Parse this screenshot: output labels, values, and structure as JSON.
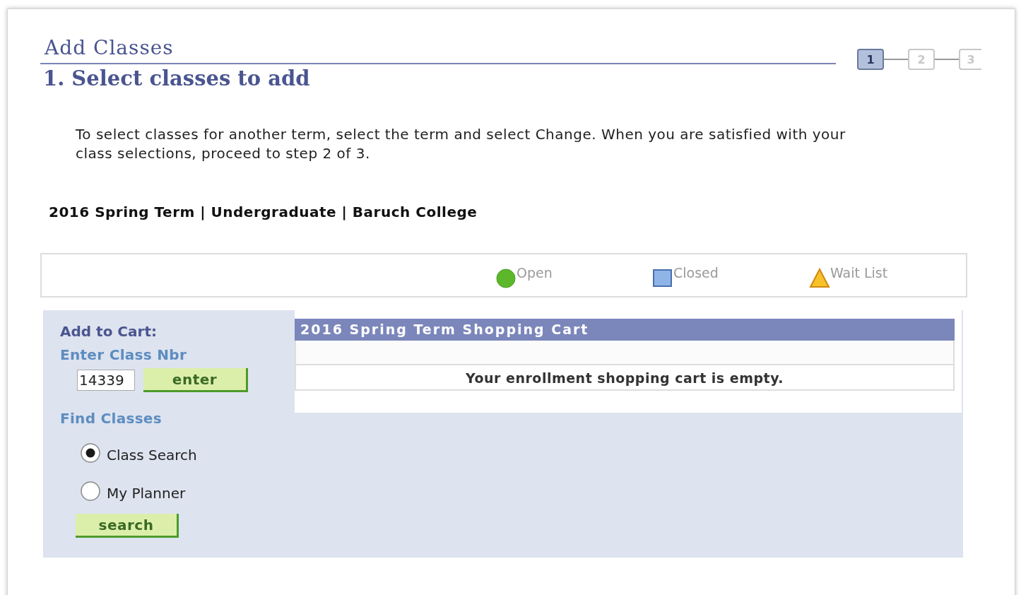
{
  "header": {
    "title": "Add Classes",
    "subtitle": "1.  Select classes to add"
  },
  "steps": [
    {
      "label": "1",
      "selected": true
    },
    {
      "label": "2",
      "selected": false
    },
    {
      "label": "3",
      "selected": false
    }
  ],
  "instructions": "To select classes for another term, select the term and select Change.  When you are satisfied with your class selections, proceed to step 2 of 3.",
  "term": "2016 Spring Term | Undergraduate | Baruch College",
  "legend": [
    {
      "kind": "circle",
      "label": "Open",
      "color": "#5cb82a"
    },
    {
      "kind": "square",
      "label": "Closed",
      "color": "#8fb4e8"
    },
    {
      "kind": "triangle",
      "label": "Wait List",
      "color": "#f7c12a"
    }
  ],
  "add_to_cart": {
    "heading": "Add to Cart:",
    "field_label": "Enter Class Nbr",
    "value": "14339",
    "button": "enter"
  },
  "find_classes": {
    "heading": "Find Classes",
    "options": [
      {
        "label": "Class Search",
        "selected": true
      },
      {
        "label": "My Planner",
        "selected": false
      }
    ],
    "button": "search"
  },
  "cart": {
    "title": "2016 Spring Term Shopping Cart",
    "message": "Your enrollment shopping cart is empty."
  }
}
